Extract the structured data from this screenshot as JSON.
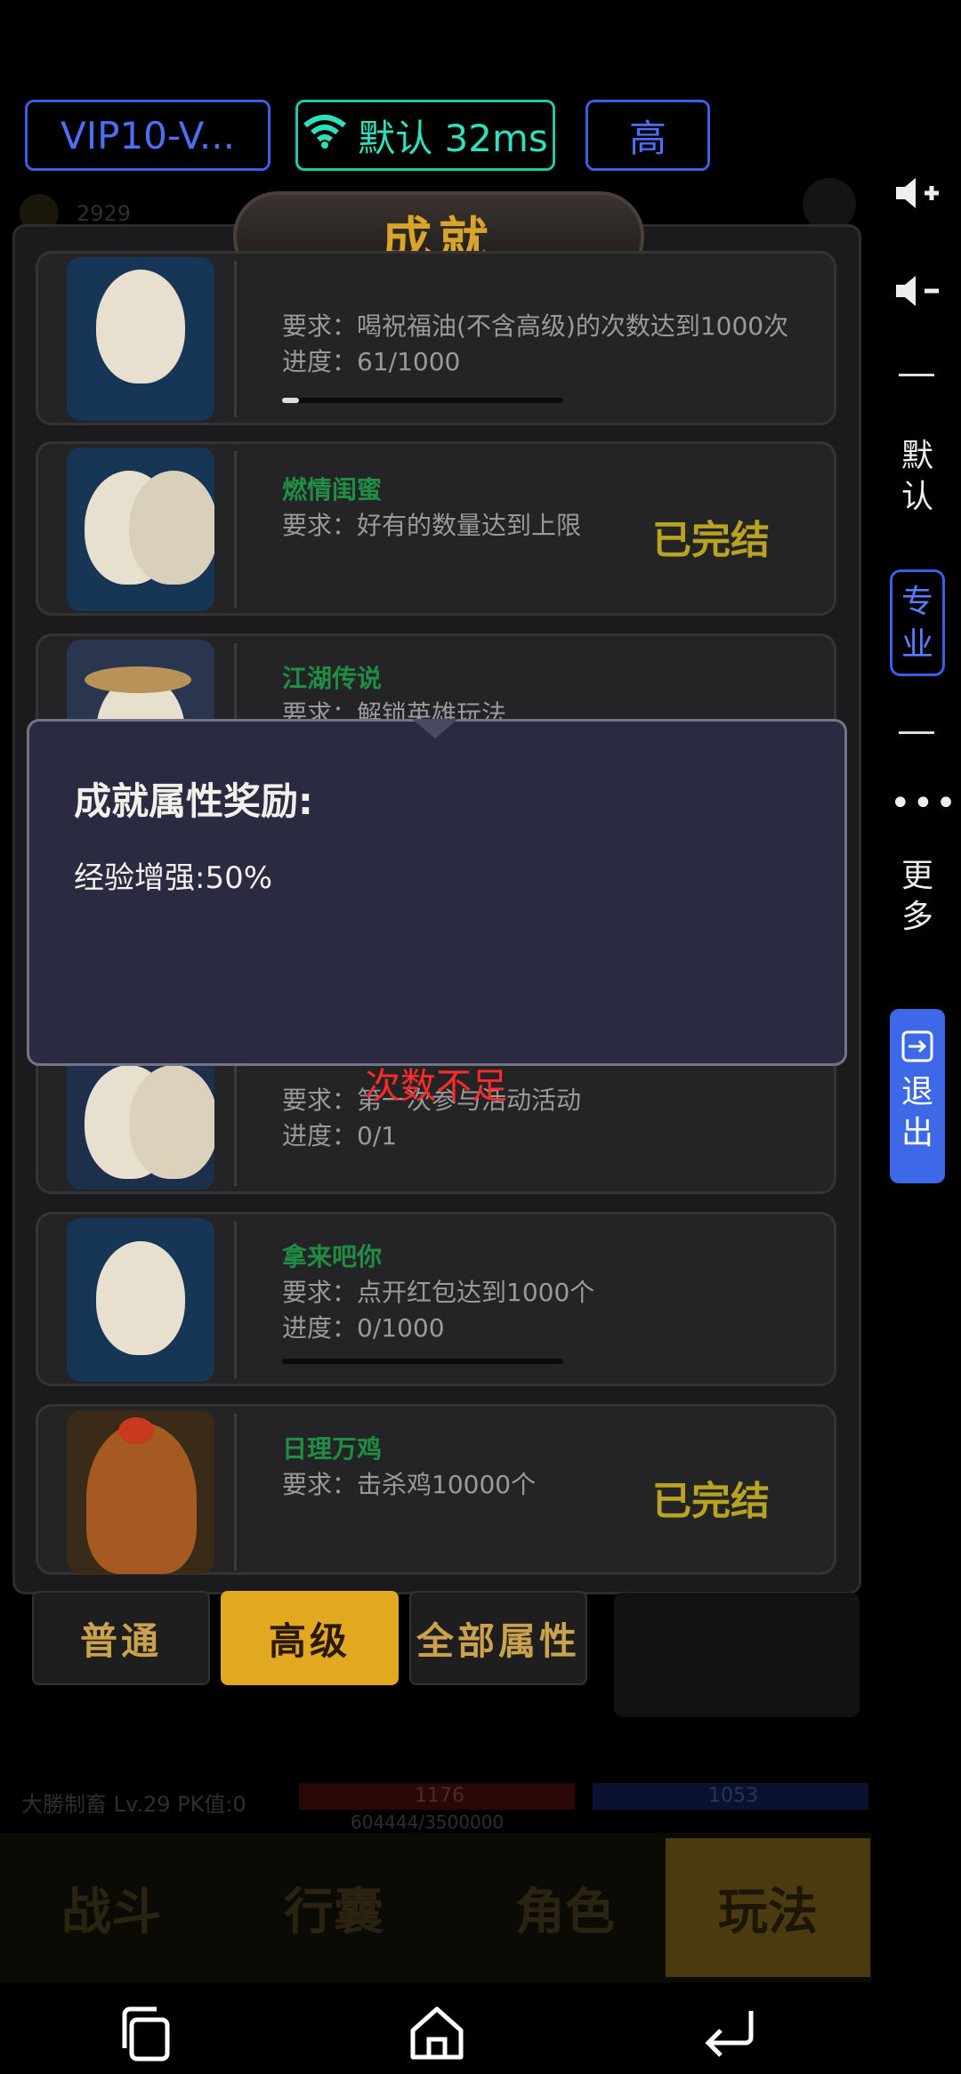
{
  "topbar": {
    "vip_label": "VIP10-V...",
    "net_label": "默认 32ms",
    "quality_label": "高"
  },
  "right_toolbar": {
    "vol_up": "volume-up-icon",
    "vol_down": "volume-down-icon",
    "default_label": "默\n认",
    "pro_label": "专\n业",
    "more_label": "更\n多",
    "exit_label": "退\n出"
  },
  "panel": {
    "title": "成就",
    "rows": [
      {
        "name": "",
        "requirement": "要求：喝祝福油(不含高级)的次数达到1000次",
        "progress": "进度：61/1000",
        "progress_value": 0.061
      },
      {
        "name": "燃情闺蜜",
        "requirement": "要求：好有的数量达到上限",
        "status": "已完结"
      },
      {
        "name": "江湖传说",
        "requirement": "要求：解锁英雄玩法"
      },
      {
        "name": "",
        "requirement": "要求：第一次参与活动活动",
        "progress": "进度：0/1"
      },
      {
        "name": "拿来吧你",
        "requirement": "要求：点开红包达到1000个",
        "progress": "进度：0/1000",
        "progress_value": 0
      },
      {
        "name": "日理万鸡",
        "requirement": "要求：击杀鸡10000个",
        "status": "已完结"
      }
    ]
  },
  "tooltip": {
    "title": "成就属性奖励:",
    "body": "经验增强:50%"
  },
  "warning": "次数不足",
  "tabs": {
    "normal": "普通",
    "advanced": "高级",
    "all_attrs": "全部属性"
  },
  "status_bar": {
    "player": "大勝制畜  Lv.29  PK值:0",
    "hp": "1176",
    "mp": "1053",
    "exp": "604444/3500000"
  },
  "game_nav": {
    "battle": "战斗",
    "bag": "行囊",
    "role": "角色",
    "play": "玩法"
  },
  "bg_hint": "2929"
}
